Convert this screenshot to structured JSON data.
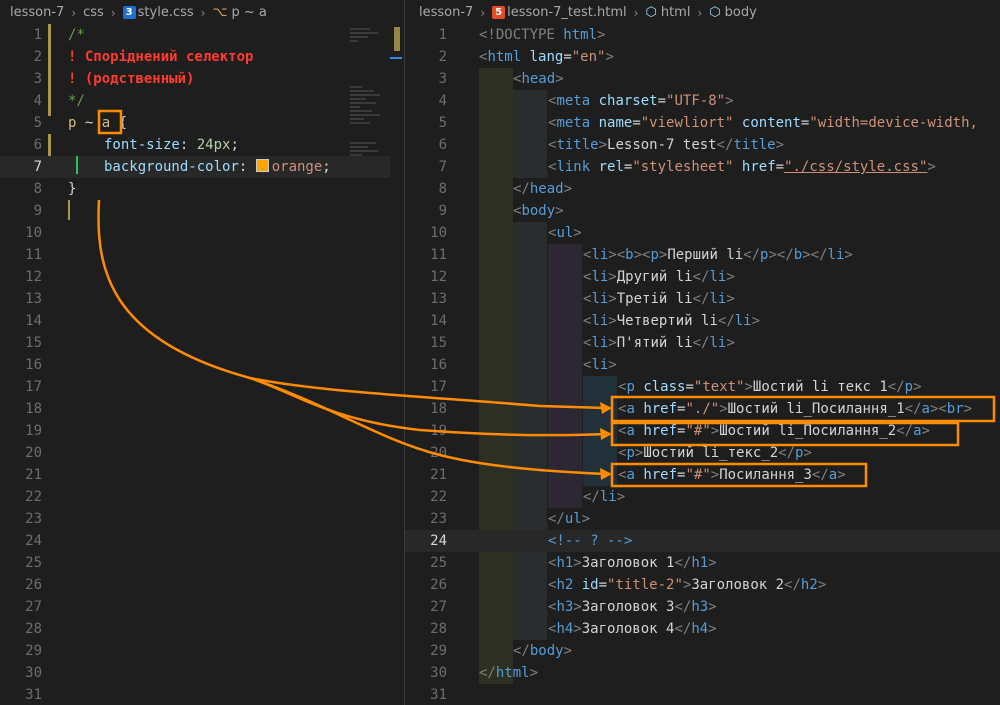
{
  "left": {
    "breadcrumb": [
      "lesson-7",
      "css",
      "style.css",
      "p ~ a"
    ],
    "active_line": 7,
    "line_count": 31
  },
  "right": {
    "breadcrumb": [
      "lesson-7",
      "lesson-7_test.html",
      "html",
      "body"
    ],
    "active_line": 24,
    "line_count": 31
  },
  "css_code": {
    "l1": "/*",
    "l2": "! Споріднений селектор",
    "l3": "! (родственный)",
    "l4": "*/",
    "l5_sel1": "p",
    "l5_op": " ~ ",
    "l5_sel2": "a",
    "l5_brace": " {",
    "l6_prop": "font-size",
    "l6_colon": ": ",
    "l6_val": "24px",
    "l6_end": ";",
    "l7_prop": "background-color",
    "l7_colon": ": ",
    "l7_val": "orange",
    "l7_end": ";",
    "l8": "}"
  },
  "html_code": {
    "doctype": "<!DOCTYPE",
    "doctype_kw": "html",
    "html": "html",
    "lang_attr": "lang",
    "lang_val": "\"en\"",
    "head": "head",
    "meta": "meta",
    "charset_attr": "charset",
    "charset_val": "\"UTF-8\"",
    "name_attr": "name",
    "name_val": "\"viewliort\"",
    "content_attr": "content",
    "content_val": "\"width=device-width,",
    "title": "title",
    "title_text": "Lesson-7 test",
    "link": "link",
    "rel_attr": "rel",
    "rel_val": "\"stylesheet\"",
    "href_attr": "href",
    "href_css": "\"./css/style.css\"",
    "body": "body",
    "ul": "ul",
    "li": "li",
    "b": "b",
    "p": "p",
    "li1": "Перший li",
    "li2": "Другий li",
    "li3": "Третій li",
    "li4": "Четвертий li",
    "li5": "П'ятий li",
    "class_attr": "class",
    "class_val": "\"text\"",
    "p1_text": "Шостий li текс 1",
    "a": "a",
    "href1": "\"./\"",
    "a1_text": "Шостий li_Посилання_1",
    "br": "br",
    "href2": "\"#\"",
    "a2_text": "Шостий li_Посилання_2",
    "p2_text": "Шостий li_текс_2",
    "href3": "\"#\"",
    "a3_text": "Посилання_3",
    "comment": "<!-- ? -->",
    "h1": "h1",
    "h1_text": "Заголовок 1",
    "h2": "h2",
    "id_attr": "id",
    "id_val": "\"title-2\"",
    "h2_text": "Заголовок 2",
    "h3": "h3",
    "h3_text": "Заголовок 3",
    "h4": "h4",
    "h4_text": "Заголовок 4"
  },
  "colors": {
    "annotation": "#ff8c00",
    "swatch": "#ffa500"
  }
}
